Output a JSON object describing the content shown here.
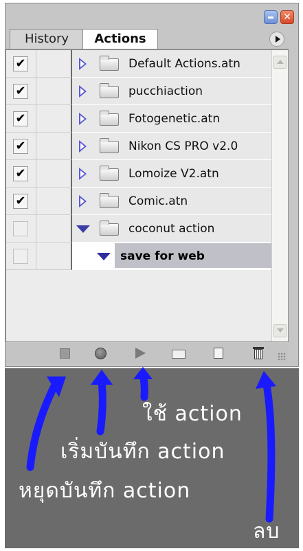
{
  "window": {
    "minimize_glyph": "",
    "close_glyph": "✕"
  },
  "tabs": [
    {
      "label": "History",
      "active": false
    },
    {
      "label": "Actions",
      "active": true
    }
  ],
  "action_sets": [
    {
      "name": "Default Actions.atn",
      "checked": true,
      "dialog": "gray",
      "expanded": false
    },
    {
      "name": "pucchiaction",
      "checked": true,
      "dialog": "gray",
      "expanded": false
    },
    {
      "name": "Fotogenetic.atn",
      "checked": true,
      "dialog": "red",
      "expanded": false
    },
    {
      "name": "Nikon CS PRO v2.0",
      "checked": true,
      "dialog": "red",
      "expanded": false
    },
    {
      "name": "Lomoize V2.atn",
      "checked": true,
      "dialog": "red",
      "expanded": false
    },
    {
      "name": "Comic.atn",
      "checked": true,
      "dialog": "red",
      "expanded": false
    },
    {
      "name": "coconut action",
      "checked": false,
      "dialog": "none",
      "expanded": true
    }
  ],
  "selected_action": {
    "name": "save for web",
    "checked": false
  },
  "toolbar": {
    "buttons": [
      "stop-recording",
      "begin-recording",
      "play-selection",
      "create-new-set",
      "create-new-action",
      "delete"
    ]
  },
  "annotations": {
    "use_action": "ใช้ action",
    "start_record": "เริ่มบันทึก action",
    "stop_record": "หยุดบันทึก action",
    "delete": "ลบ",
    "arrow_color": "#1a1aff"
  },
  "colors": {
    "panel_gray": "#6b6b6b",
    "set_triangle": "#5a5ad8",
    "dialog_red": "#c23030"
  }
}
